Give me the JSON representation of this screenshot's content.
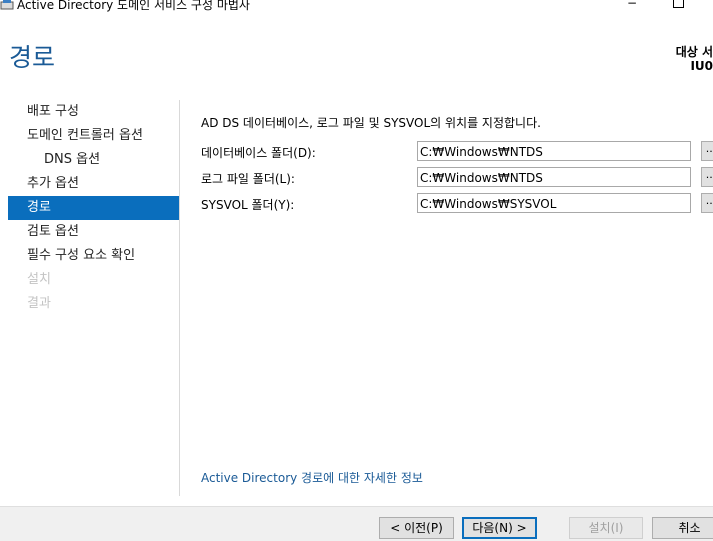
{
  "window": {
    "title": "Active Directory 도메인 서비스 구성 마법사",
    "minimize_glyph": "−"
  },
  "header": {
    "page_title": "경로",
    "target_label": "대상 서",
    "target_value": "IU0"
  },
  "nav": {
    "items": [
      {
        "label": "배포 구성"
      },
      {
        "label": "도메인 컨트롤러 옵션"
      },
      {
        "label": "DNS 옵션"
      },
      {
        "label": "추가 옵션"
      },
      {
        "label": "경로"
      },
      {
        "label": "검토 옵션"
      },
      {
        "label": "필수 구성 요소 확인"
      },
      {
        "label": "설치"
      },
      {
        "label": "결과"
      }
    ]
  },
  "main": {
    "intro": "AD DS 데이터베이스, 로그 파일 및 SYSVOL의 위치를 지정합니다.",
    "fields": [
      {
        "label": "데이터베이스 폴더(D):",
        "value": "C:₩Windows₩NTDS",
        "browse": "..."
      },
      {
        "label": "로그 파일 폴더(L):",
        "value": "C:₩Windows₩NTDS",
        "browse": "..."
      },
      {
        "label": "SYSVOL 폴더(Y):",
        "value": "C:₩Windows₩SYSVOL",
        "browse": "..."
      }
    ],
    "more_link": "Active Directory 경로에 대한 자세한 정보"
  },
  "footer": {
    "prev": "< 이전(P)",
    "next": "다음(N) >",
    "install": "설치(I)",
    "cancel": "취소"
  },
  "colors": {
    "accent": "#0a6ebd",
    "title_blue": "#1a5a96",
    "disabled_text": "#c4c4c4"
  }
}
